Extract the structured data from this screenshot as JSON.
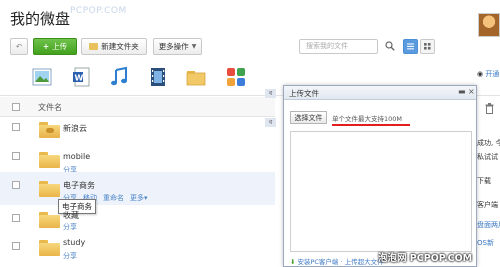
{
  "page": {
    "title": "我的微盘",
    "watermark_top": "PCPOP.COM",
    "watermark_bottom": "泡泡网  PCPOP.COM"
  },
  "toolbar": {
    "back_label": "↶",
    "upload_label": "上传",
    "new_folder_label": "新建文件夹",
    "more_actions_label": "更多操作",
    "search_placeholder": "搜索我的文件"
  },
  "file_list": {
    "column_header": "文件名",
    "items": [
      {
        "name": "新浪云",
        "share": ""
      },
      {
        "name": "mobile",
        "share": "分享"
      },
      {
        "name": "电子商务",
        "share": ""
      },
      {
        "name": "收藏",
        "share": "分享"
      },
      {
        "name": "study",
        "share": "分享"
      }
    ],
    "row_actions": [
      "分享",
      "移动",
      "重命名",
      "更多"
    ],
    "tooltip": "电子商务"
  },
  "sidebar": {
    "open_member": "开通会员",
    "snippets": [
      "成功, 今",
      "私试试",
      "下载",
      "客户端",
      "盘面两用",
      "OS新"
    ]
  },
  "middle_tabs": [
    "ব",
    "ব"
  ],
  "upload_dialog": {
    "title": "上传文件",
    "choose_file": "选择文件",
    "size_limit": "单个文件最大支持100M",
    "footer": "安装PC客户端 · 上传超大文件"
  },
  "colors": {
    "upload_green": "#43a11d",
    "link_blue": "#4a84c8",
    "limit_underline_red": "#e02020"
  }
}
